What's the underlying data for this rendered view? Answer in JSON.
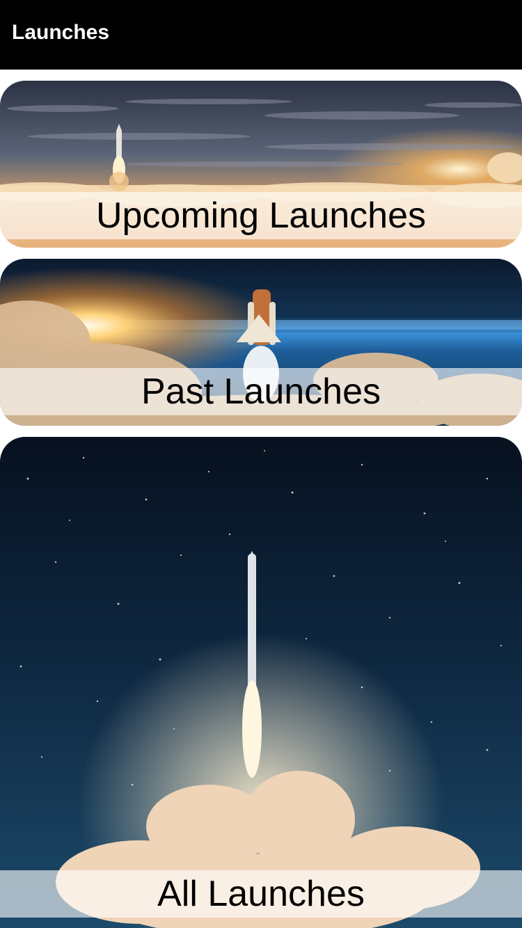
{
  "header": {
    "title": "Launches"
  },
  "cards": [
    {
      "label": "Upcoming Launches",
      "image": "sunset-rocket-above-clouds"
    },
    {
      "label": "Past Launches",
      "image": "space-shuttle-earth-orbit"
    },
    {
      "label": "All Launches",
      "image": "rocket-night-sky-liftoff"
    }
  ],
  "colors": {
    "navbar_bg": "#000000",
    "nav_text": "#ffffff",
    "caption_band": "rgba(255,255,255,0.62)",
    "caption_text": "#000000"
  }
}
